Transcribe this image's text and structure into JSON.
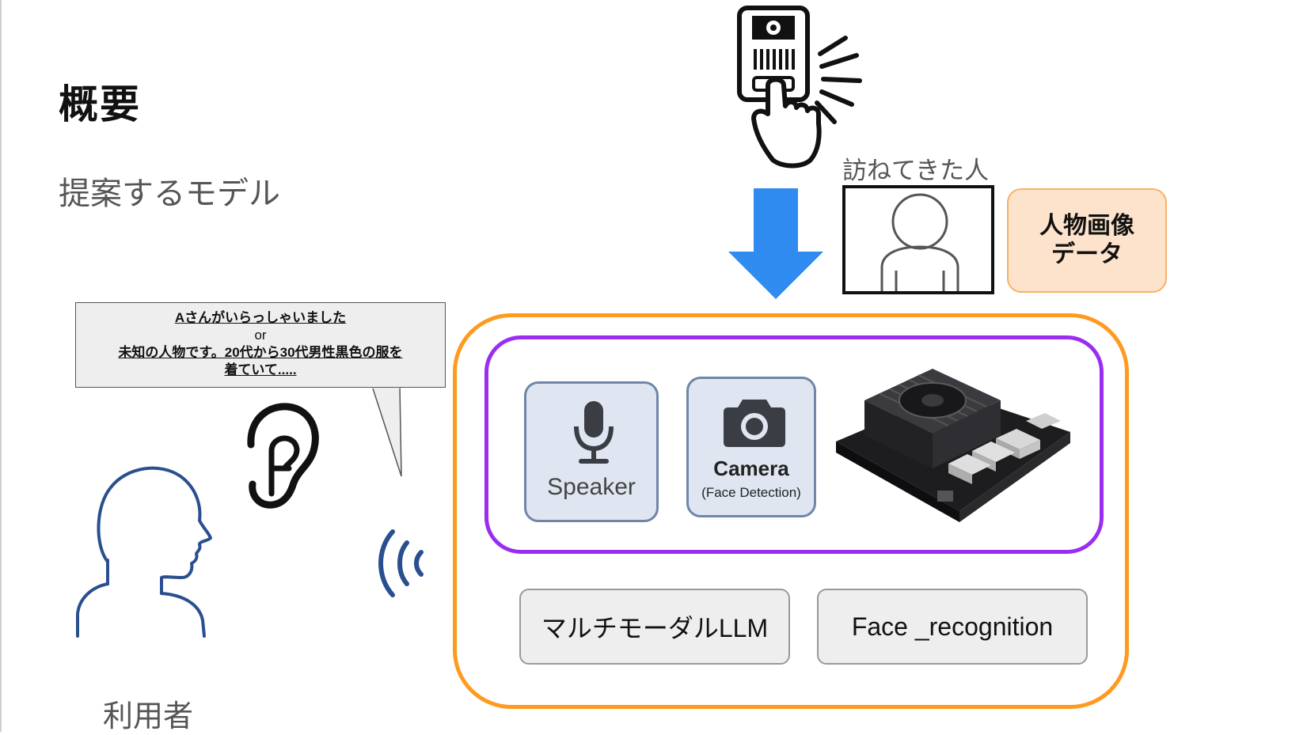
{
  "slide": {
    "title": "概要",
    "subtitle": "提案するモデル"
  },
  "speech_bubble": {
    "line1": "Aさんがいらっしゃいました",
    "line2": "or",
    "line3": "未知の人物です。20代から30代男性黒色の服を",
    "line4": "着ていて....."
  },
  "visitor": {
    "label": "訪ねてきた人"
  },
  "person_data": {
    "line1": "人物画像",
    "line2": "データ"
  },
  "devices": {
    "speaker_label": "Speaker",
    "camera_label": "Camera",
    "camera_sub": "(Face Detection)",
    "board_icon": "jetson-board-icon"
  },
  "software": {
    "llm": "マルチモーダルLLM",
    "face": "Face _recognition"
  },
  "user": {
    "label": "利用者"
  },
  "colors": {
    "arrow": "#2f8bf0",
    "outer_box": "#ff9a1f",
    "inner_box": "#9b2df0",
    "data_box_fill": "#fde3cb",
    "user_icon": "#2a4f8f"
  }
}
